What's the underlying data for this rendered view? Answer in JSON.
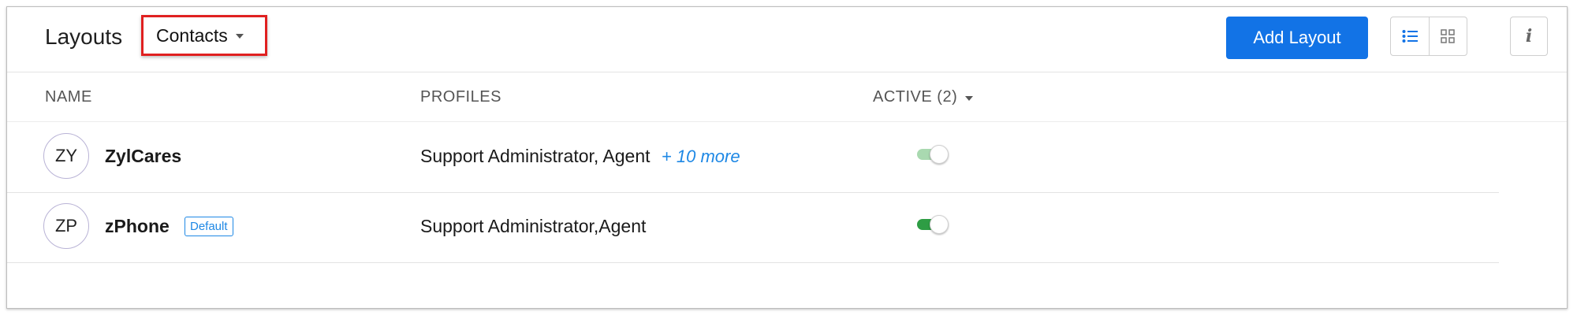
{
  "header": {
    "title": "Layouts",
    "module_select": "Contacts",
    "add_button": "Add Layout",
    "info_button": "i"
  },
  "columns": {
    "name": "NAME",
    "profiles": "PROFILES",
    "active": "ACTIVE (2)"
  },
  "rows": [
    {
      "initials": "ZY",
      "name": "ZylCares",
      "profiles": "Support Administrator, Agent",
      "more": "+ 10 more",
      "active": true,
      "toggle_state": "dimmed"
    },
    {
      "initials": "ZP",
      "name": "zPhone",
      "badge": "Default",
      "profiles": "Support Administrator,Agent",
      "active": true,
      "toggle_state": "on"
    }
  ],
  "colors": {
    "primary_button": "#1273e6",
    "link": "#1e88e5",
    "toggle_on": "#2e9d44",
    "toggle_dimmed": "#a9d9b0",
    "highlight_border": "#e02020"
  },
  "icons": {
    "list_view": "list-view-icon",
    "grid_view": "grid-view-icon",
    "info": "info-icon",
    "dropdown": "chevron-down-icon"
  }
}
